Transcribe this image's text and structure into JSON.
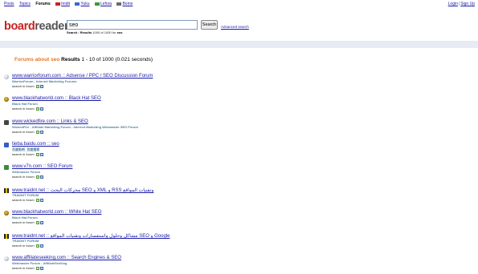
{
  "topnav": {
    "items": [
      {
        "label": "Posts",
        "active": false
      },
      {
        "label": "Topics",
        "active": false
      },
      {
        "label": "Forums",
        "active": true
      },
      {
        "label": "Imdit",
        "active": false,
        "flag": "#c8221f"
      },
      {
        "label": "Yuku",
        "active": false,
        "flag": "#3a6ac8"
      },
      {
        "label": "Lefora",
        "active": false,
        "flag": "#3a9a3a"
      },
      {
        "label": "Boms",
        "active": false,
        "flag": "#6a6a6a"
      }
    ],
    "login": "Login",
    "signup": "Sign Up"
  },
  "logo": {
    "board": "board",
    "reader": "reader",
    "mark": "®"
  },
  "search": {
    "query": "seo",
    "button": "Search",
    "advanced": "Advanced search",
    "hint_prefix": "Search",
    "hint_mid": "/",
    "hint_results": "Results",
    "hint_text": "1000 of 1000 for",
    "hint_query": "seo"
  },
  "results_header": {
    "forums_about": "Forums about seo",
    "results_label": "Results",
    "range": "1 - 10 of 1000 (0.021 seconds)"
  },
  "results": [
    {
      "icon": "globe-icon",
      "title": "www.warriorforum.com :: Adsense / PPC / SEO Discussion Forum",
      "sub": "WarriorForum - Internet Marketing Forums",
      "sif": "search in forum"
    },
    {
      "icon": "bhw-icon",
      "title": "www.blackhatworld.com :: Black Hat SEO",
      "sub": "Black Hat Forum",
      "sif": "search in forum"
    },
    {
      "icon": "wickedfire-icon",
      "title": "www.wickedfire.com :: Links & SEO",
      "sub": "WickedFire - Affiliate Marketing Forum - Internet Marketing Webmaster SEO Forum",
      "sif": "search in forum"
    },
    {
      "icon": "baidu-icon",
      "title": "tieba.baidu.com :: seo",
      "sub": "百度贴吧_百度搜索",
      "sif": "search in forum"
    },
    {
      "icon": "v7n-icon",
      "title": "www.v7n.com :: SEO Forum",
      "sub": "Webmaster Forum",
      "sif": "search in forum"
    },
    {
      "icon": "traidnt-icon",
      "title": "www.traidnt.net :: محركات البحث SEO و XML و RSS وتقنيات المواقع",
      "sub": "TRAIDNT FORUM",
      "sif": "search in forum"
    },
    {
      "icon": "bhw-icon",
      "title": "www.blackhatworld.com :: White Hat SEO",
      "sub": "Black Hat Forum",
      "sif": "search in forum"
    },
    {
      "icon": "traidnt-icon",
      "title": "www.traidnt.net :: مشاكل وحلول واستفسارات وتقنيات المواقع SEO و Google",
      "sub": "TRAIDNT FORUM",
      "sif": "search in forum"
    },
    {
      "icon": "globe-icon",
      "title": "www.affiliateseeking.com :: Search Engines & SEO",
      "sub": "Webmaster Forum - AffiliateSeeking",
      "sif": "search in forum"
    }
  ]
}
